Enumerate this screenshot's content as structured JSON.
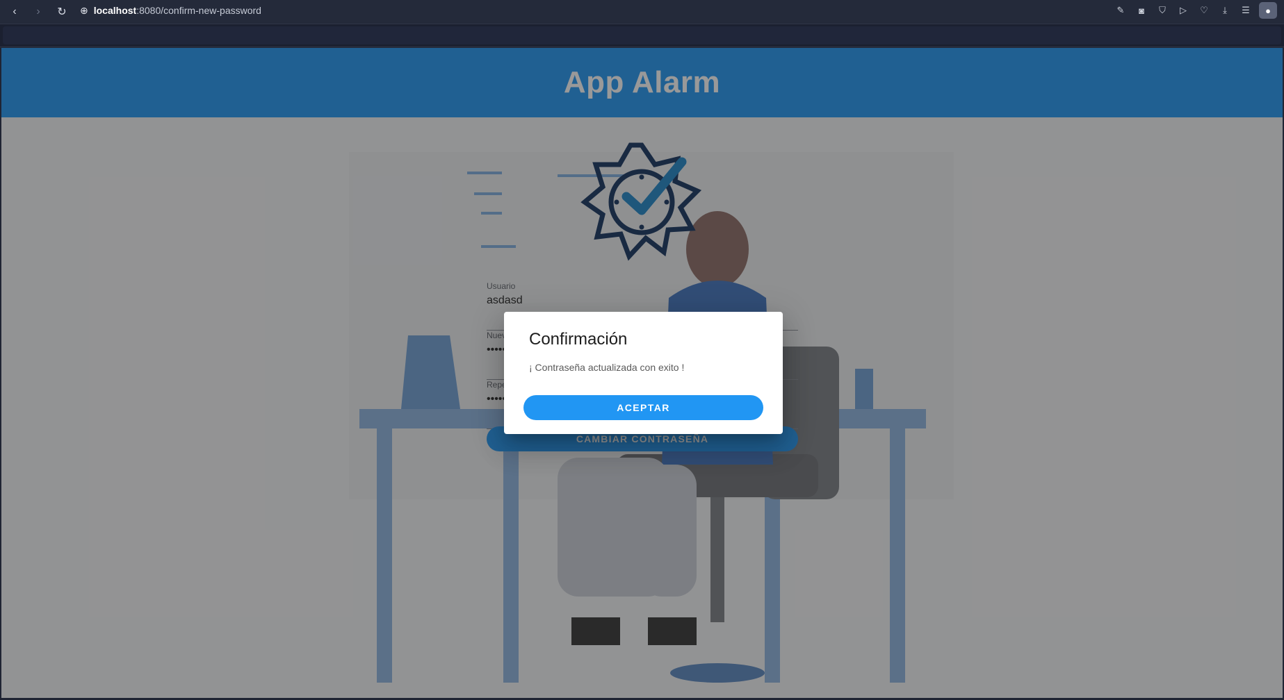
{
  "browser": {
    "url_host": "localhost",
    "url_rest": ":8080/confirm-new-password"
  },
  "app": {
    "title": "App Alarm",
    "brand_color": "#2196f3"
  },
  "form": {
    "user_label": "Usuario",
    "user_value": "asdasd",
    "new_password_label": "Nueva contraseña",
    "new_password_value": "••••••",
    "repeat_password_label": "Repetir contraseña",
    "repeat_password_value": "••••••",
    "submit_label": "CAMBIAR CONTRASEÑA"
  },
  "dialog": {
    "title": "Confirmación",
    "message": "¡ Contraseña actualizada con exito !",
    "accept_label": "ACEPTAR"
  }
}
